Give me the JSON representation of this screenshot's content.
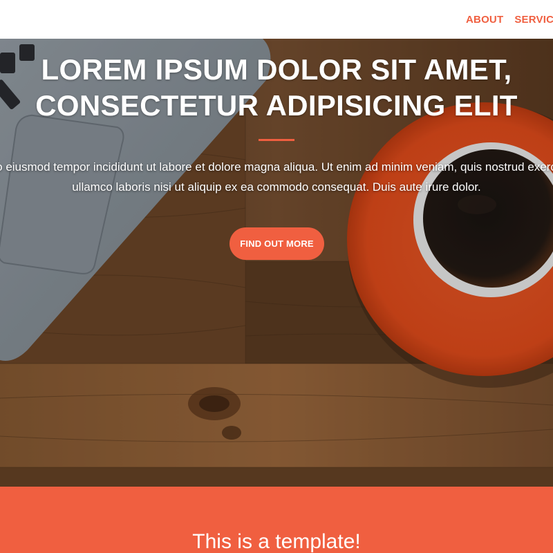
{
  "colors": {
    "accent": "#f05f40",
    "white": "#ffffff"
  },
  "navbar": {
    "links": [
      {
        "label": "ABOUT"
      },
      {
        "label": "SERVICES"
      }
    ]
  },
  "hero": {
    "title": "LOREM IPSUM DOLOR SIT AMET, CONSECTETUR ADIPISICING ELIT",
    "text": "Sed do eiusmod tempor incididunt ut labore et dolore magna aliqua. Ut enim ad minim veniam, quis nostrud exercitation ullamco laboris nisi ut aliquip ex ea commodo consequat. Duis aute irure dolor.",
    "cta_label": "FIND OUT MORE",
    "background_icons": {
      "laptop": "laptop-icon",
      "coffee": "coffee-cup-icon"
    }
  },
  "section": {
    "title": "This is a template!"
  }
}
